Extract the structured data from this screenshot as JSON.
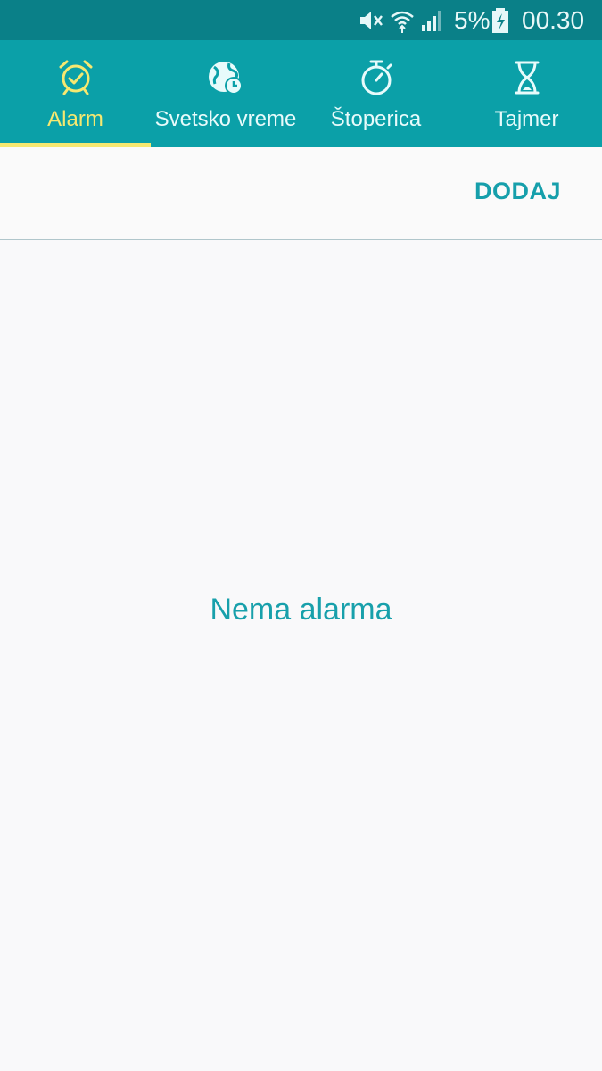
{
  "status_bar": {
    "battery_percent": "5%",
    "time": "00.30",
    "icons": [
      "mute-icon",
      "wifi-icon",
      "signal-icon",
      "battery-charging-icon"
    ]
  },
  "tabs": [
    {
      "label": "Alarm",
      "icon": "alarm-clock-icon",
      "active": true
    },
    {
      "label": "Svetsko vreme",
      "icon": "world-clock-icon",
      "active": false
    },
    {
      "label": "Štoperica",
      "icon": "stopwatch-icon",
      "active": false
    },
    {
      "label": "Tajmer",
      "icon": "hourglass-icon",
      "active": false
    }
  ],
  "actions": {
    "add_label": "DODAJ"
  },
  "main": {
    "empty_message": "Nema alarma"
  },
  "colors": {
    "status_bar": "#0a8088",
    "tab_bar": "#0ba0a8",
    "active_tab": "#f6e870",
    "accent_text": "#169fab",
    "background": "#f9f9fa"
  }
}
